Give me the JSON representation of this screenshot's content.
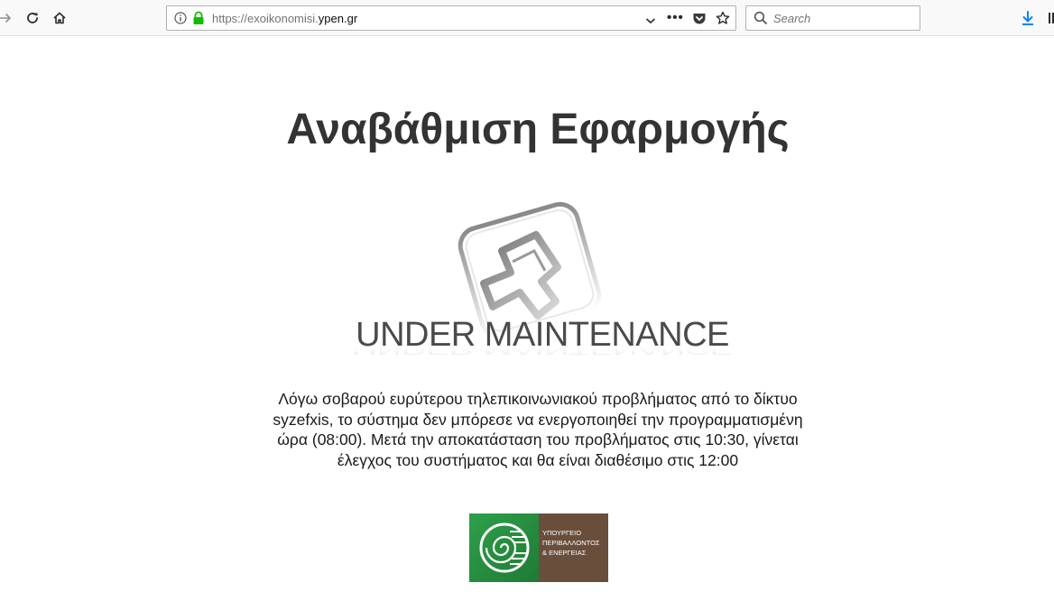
{
  "browser": {
    "url_prefix": "https://exoikonomisi.",
    "url_host": "ypen.gr",
    "search_placeholder": "Search",
    "icons": [
      "forward-icon",
      "reload-icon",
      "home-icon",
      "info-icon",
      "lock-icon",
      "dropdown-icon",
      "more-icon",
      "pocket-icon",
      "bookmark-star-icon",
      "search-icon",
      "download-icon",
      "library-icon"
    ]
  },
  "page": {
    "title": "Αναβάθμιση Εφαρμογής",
    "maintenance_label": "UNDER MAINTENANCE",
    "message": "Λόγω σοβαρού ευρύτερου τηλεπικοινωνιακού προβλήματος από το δίκτυο syzefxis, το σύστημα δεν μπόρεσε να ενεργοποιηθεί την προγραμματισμένη ώρα (08:00). Μετά την αποκατάσταση του προβλήματος στις 10:30, γίνεται έλεγχος του συστήματος και θα είναι διαθέσιμο στις 12:00",
    "logo": {
      "line1": "ΥΠΟΥΡΓΕΙΟ",
      "line2": "ΠΕΡΙΒΑΛΛΟΝΤΟΣ",
      "line3": "& ΕΝΕΡΓΕΙΑΣ"
    }
  },
  "colors": {
    "title": "#333333",
    "logo_green": "#2fa04a",
    "logo_brown": "#6a4e3c",
    "download_accent": "#0a84ff"
  }
}
